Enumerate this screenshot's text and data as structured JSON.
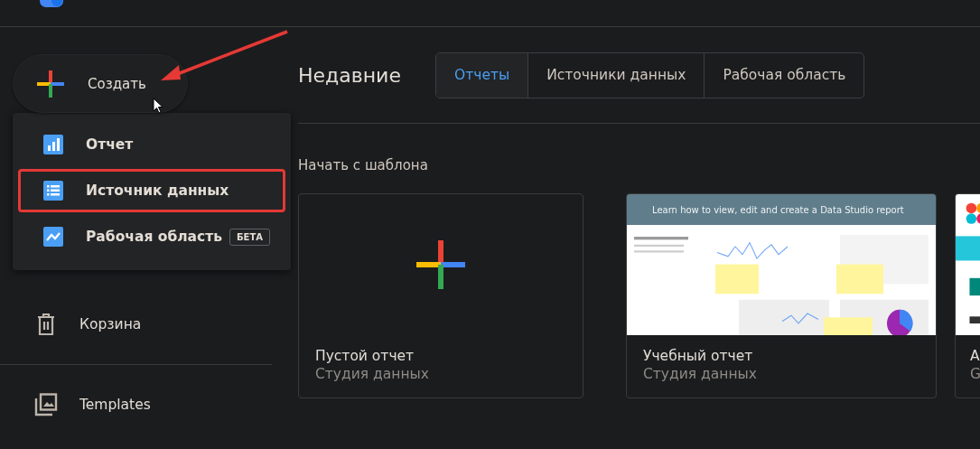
{
  "create_button": {
    "label": "Создать"
  },
  "create_menu": {
    "items": [
      {
        "label": "Отчет",
        "kind": "report",
        "annotated": false
      },
      {
        "label": "Источник данных",
        "kind": "datasource",
        "annotated": true
      },
      {
        "label": "Рабочая область",
        "kind": "explorer",
        "badge": "БЕТА",
        "annotated": false
      }
    ]
  },
  "sidebar": {
    "items": [
      {
        "label": "Корзина",
        "kind": "trash"
      },
      {
        "label": "Templates",
        "kind": "templates"
      }
    ]
  },
  "recent": {
    "title": "Недавние",
    "tabs": [
      {
        "label": "Отчеты",
        "selected": true
      },
      {
        "label": "Источники данных",
        "selected": false
      },
      {
        "label": "Рабочая область",
        "selected": false
      }
    ]
  },
  "templates": {
    "heading": "Начать с шаблона",
    "cards": [
      {
        "kind": "blank",
        "title": "Пустой отчет",
        "subtitle": "Студия данных"
      },
      {
        "kind": "tutorial",
        "thumbnail_title": "Learn how  to view, edit and create a Data Studio report",
        "title": "Учебный отчет",
        "subtitle": "Студия данных"
      },
      {
        "kind": "marketing",
        "title": "A",
        "subtitle": "G"
      }
    ]
  }
}
